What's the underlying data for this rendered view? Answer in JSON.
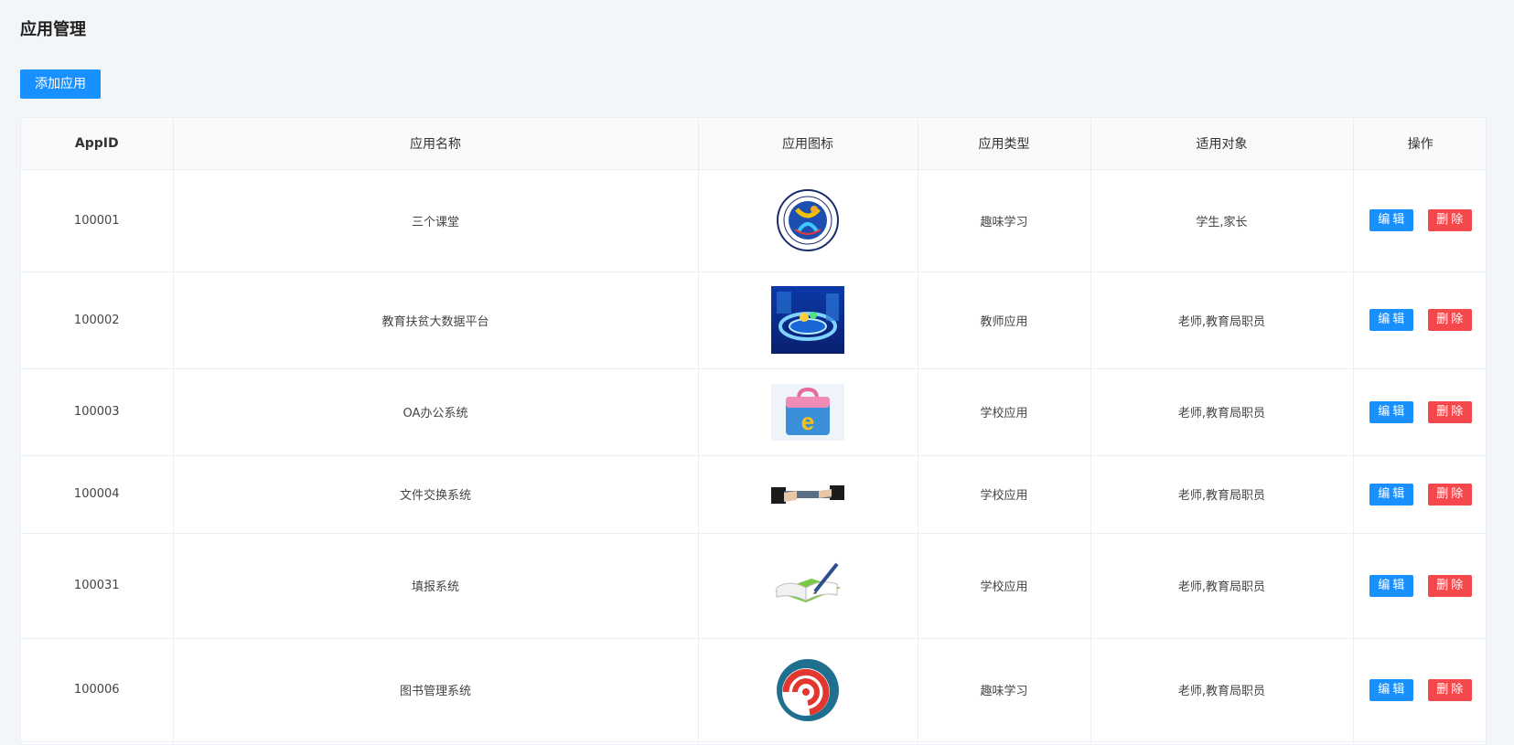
{
  "page": {
    "title": "应用管理"
  },
  "toolbar": {
    "add_label": "添加应用"
  },
  "table": {
    "headers": [
      "AppID",
      "应用名称",
      "应用图标",
      "应用类型",
      "适用对象",
      "操作"
    ],
    "actions": {
      "edit": "编辑",
      "delete": "删除"
    },
    "rows": [
      {
        "id": "100001",
        "name": "三个课堂",
        "icon": "school-emblem-icon",
        "type": "趣味学习",
        "target": "学生,家长"
      },
      {
        "id": "100002",
        "name": "教育扶贫大数据平台",
        "icon": "data-platform-icon",
        "type": "教师应用",
        "target": "老师,教育局职员"
      },
      {
        "id": "100003",
        "name": "OA办公系统",
        "icon": "office-bag-icon",
        "type": "学校应用",
        "target": "老师,教育局职员"
      },
      {
        "id": "100004",
        "name": "文件交换系统",
        "icon": "file-exchange-icon",
        "type": "学校应用",
        "target": "老师,教育局职员"
      },
      {
        "id": "100031",
        "name": "填报系统",
        "icon": "notebook-pen-icon",
        "type": "学校应用",
        "target": "老师,教育局职员"
      },
      {
        "id": "100006",
        "name": "图书管理系统",
        "icon": "swirl-logo-icon",
        "type": "趣味学习",
        "target": "老师,教育局职员"
      }
    ]
  }
}
